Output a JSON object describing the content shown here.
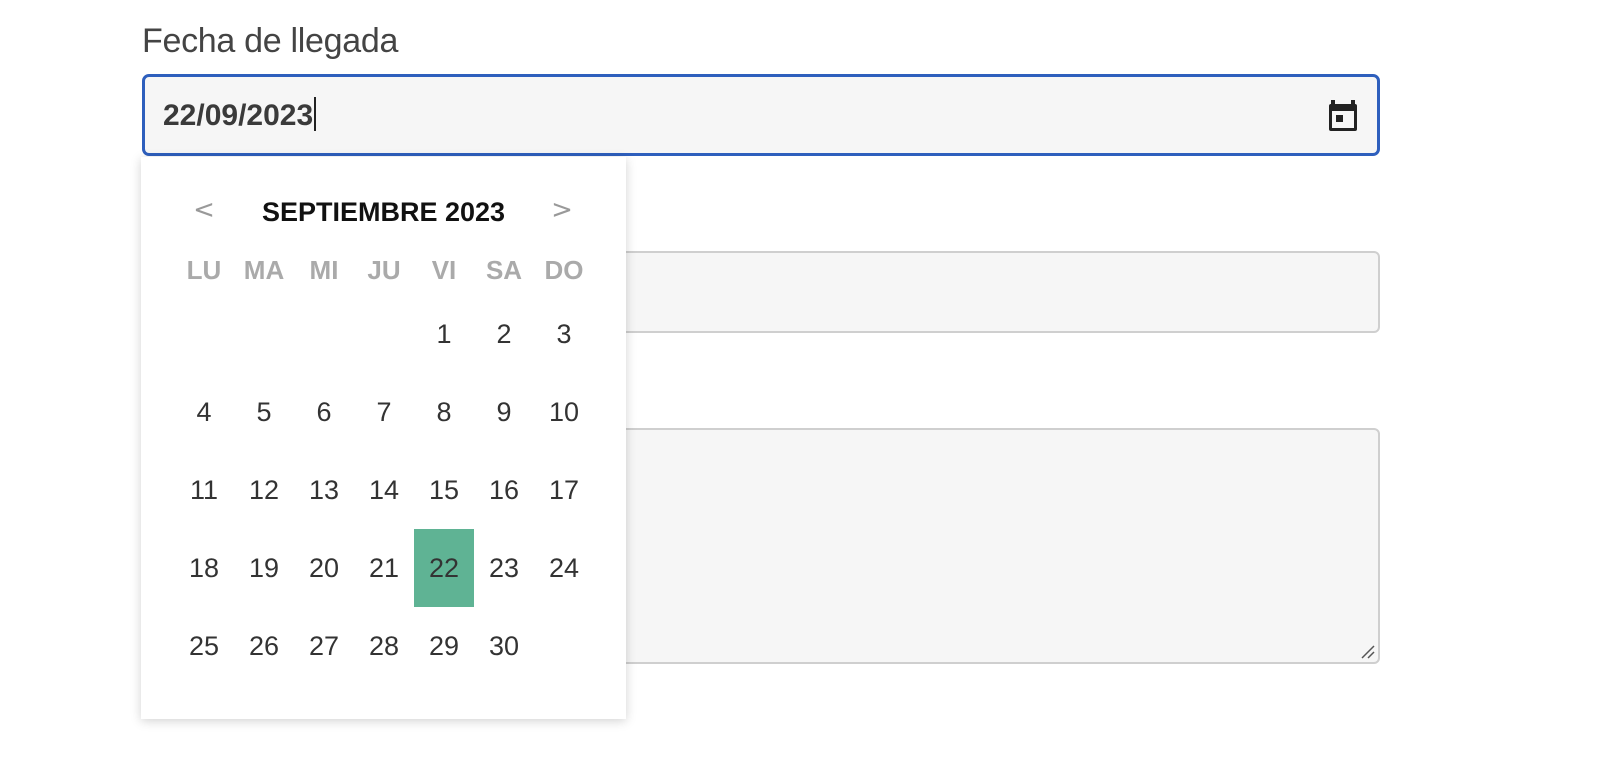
{
  "arrival": {
    "label": "Fecha de llegada",
    "value": "22/09/2023",
    "icon": "calendar-icon"
  },
  "datepicker": {
    "prev": "<",
    "next": ">",
    "month_title": "SEPTIEMBRE 2023",
    "weekdays": [
      "LU",
      "MA",
      "MI",
      "JU",
      "VI",
      "SA",
      "DO"
    ],
    "first_weekday_index": 4,
    "days": [
      "1",
      "2",
      "3",
      "4",
      "5",
      "6",
      "7",
      "8",
      "9",
      "10",
      "11",
      "12",
      "13",
      "14",
      "15",
      "16",
      "17",
      "18",
      "19",
      "20",
      "21",
      "22",
      "23",
      "24",
      "25",
      "26",
      "27",
      "28",
      "29",
      "30"
    ],
    "selected_day": "22",
    "selected_color": "#5fb394"
  },
  "colors": {
    "focus_border": "#2e5fbd",
    "field_background": "#f6f6f6"
  }
}
